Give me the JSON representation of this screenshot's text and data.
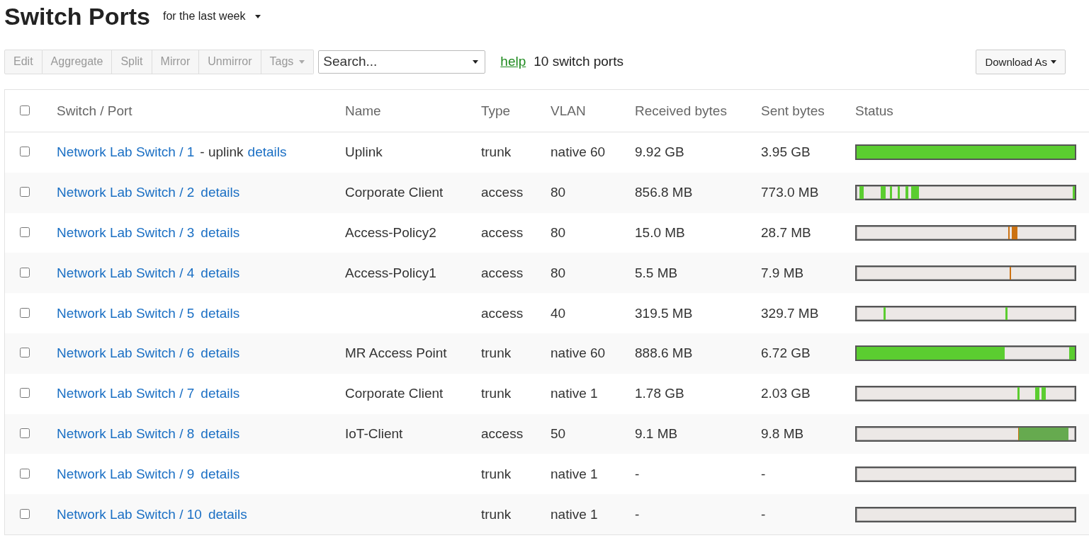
{
  "page": {
    "title": "Switch Ports",
    "time_range": "for the last week"
  },
  "toolbar": {
    "buttons": [
      {
        "label": "Edit",
        "disabled": true,
        "dropdown": false
      },
      {
        "label": "Aggregate",
        "disabled": true,
        "dropdown": false
      },
      {
        "label": "Split",
        "disabled": true,
        "dropdown": false
      },
      {
        "label": "Mirror",
        "disabled": true,
        "dropdown": false
      },
      {
        "label": "Unmirror",
        "disabled": true,
        "dropdown": false
      },
      {
        "label": "Tags",
        "disabled": true,
        "dropdown": true
      }
    ],
    "search": {
      "placeholder": "Search..."
    },
    "help_link": "help",
    "count": "10 switch ports",
    "download": "Download As"
  },
  "table": {
    "select_all_checked": false,
    "columns": [
      "Switch / Port",
      "Name",
      "Type",
      "VLAN",
      "Received bytes",
      "Sent bytes",
      "Status"
    ],
    "rows": [
      {
        "checked": false,
        "port": "Network Lab Switch / 1",
        "note": "- uplink",
        "details": "details",
        "name": "Uplink",
        "type": "trunk",
        "vlan": "native 60",
        "received": "9.92 GB",
        "sent": "3.95 GB"
      },
      {
        "checked": false,
        "port": "Network Lab Switch / 2",
        "details": "details",
        "name": "Corporate Client",
        "type": "access",
        "vlan": "80",
        "received": "856.8 MB",
        "sent": "773.0 MB"
      },
      {
        "checked": false,
        "port": "Network Lab Switch / 3",
        "details": "details",
        "name": "Access-Policy2",
        "type": "access",
        "vlan": "80",
        "received": "15.0 MB",
        "sent": "28.7 MB"
      },
      {
        "checked": false,
        "port": "Network Lab Switch / 4",
        "details": "details",
        "name": "Access-Policy1",
        "type": "access",
        "vlan": "80",
        "received": "5.5 MB",
        "sent": "7.9 MB"
      },
      {
        "checked": false,
        "port": "Network Lab Switch / 5",
        "details": "details",
        "type": "access",
        "vlan": "40",
        "received": "319.5 MB",
        "sent": "329.7 MB"
      },
      {
        "checked": false,
        "port": "Network Lab Switch / 6",
        "details": "details",
        "name": "MR Access Point",
        "type": "trunk",
        "vlan": "native 60",
        "received": "888.6 MB",
        "sent": "6.72 GB"
      },
      {
        "checked": false,
        "port": "Network Lab Switch / 7",
        "details": "details",
        "name": "Corporate Client",
        "type": "trunk",
        "vlan": "native 1",
        "received": "1.78 GB",
        "sent": "2.03 GB"
      },
      {
        "checked": false,
        "port": "Network Lab Switch / 8",
        "details": "details",
        "name": "IoT-Client",
        "type": "access",
        "vlan": "50",
        "received": "9.1 MB",
        "sent": "9.8 MB"
      },
      {
        "checked": false,
        "port": "Network Lab Switch / 9",
        "details": "details",
        "type": "trunk",
        "vlan": "native 1",
        "received": "-",
        "sent": "-"
      },
      {
        "checked": false,
        "port": "Network Lab Switch / 10",
        "details": "details",
        "type": "trunk",
        "vlan": "native 1",
        "received": "-",
        "sent": "-"
      }
    ]
  }
}
